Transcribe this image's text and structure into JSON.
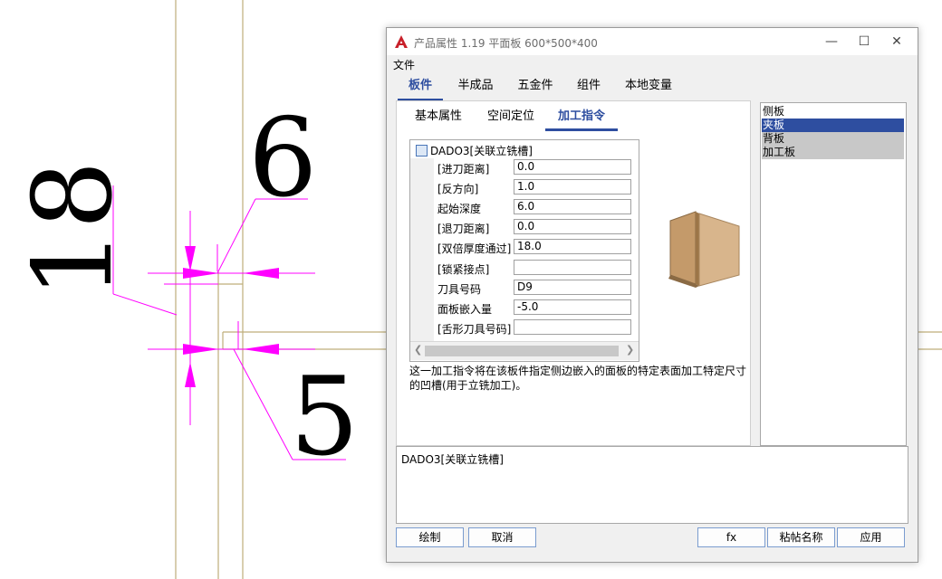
{
  "cad_drawing": {
    "dimensions": [
      "18",
      "6",
      "5"
    ],
    "colors": {
      "dimension": "#ff00ff",
      "geometry": "#bfae7a",
      "text": "#000000"
    }
  },
  "window": {
    "title": "产品属性 1.19 平面板 600*500*400",
    "app_icon": "autocad-a-icon",
    "controls": {
      "minimize": "—",
      "maximize": "☐",
      "close": "✕"
    }
  },
  "menu": {
    "file": "文件"
  },
  "tabs": [
    "板件",
    "半成品",
    "五金件",
    "组件",
    "本地变量"
  ],
  "active_tab": "板件",
  "subtabs": [
    "基本属性",
    "空间定位",
    "加工指令"
  ],
  "active_subtab": "加工指令",
  "instruction": {
    "name": "DADO3[关联立铣槽]",
    "properties": [
      {
        "label": "[进刀距离]",
        "value": "0.0"
      },
      {
        "label": "[反方向]",
        "value": "1.0"
      },
      {
        "label": "起始深度",
        "value": "6.0"
      },
      {
        "label": "[退刀距离]",
        "value": "0.0"
      },
      {
        "label": "[双倍厚度通过]",
        "value": "18.0"
      },
      {
        "label": "[锁紧接点]",
        "value": ""
      },
      {
        "label": "刀具号码",
        "value": "D9"
      },
      {
        "label": "面板嵌入量",
        "value": "-5.0"
      },
      {
        "label": "[舌形刀具号码]",
        "value": ""
      }
    ],
    "description": "这一加工指令将在该板件指定侧边嵌入的面板的特定表面加工特定尺寸的凹槽(用于立铣加工)。"
  },
  "side_list": [
    {
      "label": "侧板",
      "state": "normal"
    },
    {
      "label": "夹板",
      "state": "selected"
    },
    {
      "label": "背板",
      "state": "grey"
    },
    {
      "label": "加工板",
      "state": "grey"
    }
  ],
  "bottom_text": "DADO3[关联立铣槽]",
  "buttons": {
    "draw": "绘制",
    "cancel": "取消",
    "fx": "fx",
    "paste_name": "粘帖名称",
    "apply": "应用"
  },
  "colors": {
    "accent": "#2e4ea0",
    "selection": "#2e4ea0",
    "grey_item": "#c8c8c8"
  }
}
